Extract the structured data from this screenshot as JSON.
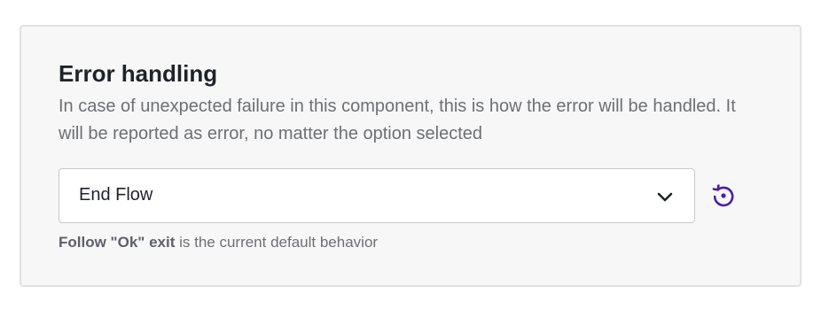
{
  "section": {
    "title": "Error handling",
    "description": "In case of unexpected failure in this component, this is how the error will be handled. It will be reported as error, no matter the option selected"
  },
  "select": {
    "selected_value": "End Flow",
    "icon": "chevron-down-icon"
  },
  "reset": {
    "icon": "reset-to-default-icon",
    "color": "#4a1fa8"
  },
  "hint": {
    "default_option": "Follow \"Ok\" exit",
    "suffix": " is the current default behavior"
  },
  "colors": {
    "panel_background": "#f7f7f7",
    "panel_border": "#e1e1e1",
    "accent": "#4a1fa8"
  }
}
